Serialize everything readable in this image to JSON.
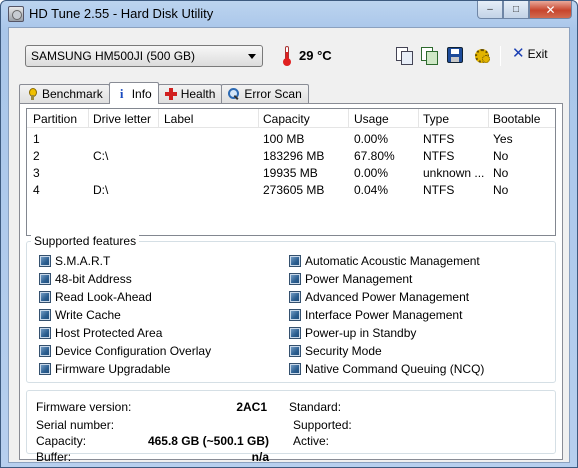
{
  "window": {
    "title": "HD Tune 2.55 - Hard Disk Utility",
    "minimize": "–",
    "maximize": "□",
    "close": "✕"
  },
  "toolbar": {
    "drive": "SAMSUNG HM500JI (500 GB)",
    "temperature": "29 °C",
    "exit_label": "Exit",
    "icons": [
      "copy-text-icon",
      "copy-screenshot-icon",
      "save-icon",
      "options-icon",
      "exit-icon"
    ]
  },
  "tabs": [
    {
      "label": "Benchmark",
      "icon": "benchmark-icon",
      "active": false
    },
    {
      "label": "Info",
      "icon": "info-icon",
      "active": true
    },
    {
      "label": "Health",
      "icon": "health-icon",
      "active": false
    },
    {
      "label": "Error Scan",
      "icon": "error-scan-icon",
      "active": false
    }
  ],
  "partitions": {
    "columns": [
      "Partition",
      "Drive letter",
      "Label",
      "Capacity",
      "Usage",
      "Type",
      "Bootable"
    ],
    "rows": [
      [
        "1",
        "",
        "",
        "100 MB",
        "0.00%",
        "NTFS",
        "Yes"
      ],
      [
        "2",
        "C:\\",
        "",
        "183296 MB",
        "67.80%",
        "NTFS",
        "No"
      ],
      [
        "3",
        "",
        "",
        "19935 MB",
        "0.00%",
        "unknown ...",
        "No"
      ],
      [
        "4",
        "D:\\",
        "",
        "273605 MB",
        "0.04%",
        "NTFS",
        "No"
      ]
    ]
  },
  "features": {
    "title": "Supported features",
    "left": [
      "S.M.A.R.T",
      "48-bit Address",
      "Read Look-Ahead",
      "Write Cache",
      "Host Protected Area",
      "Device Configuration Overlay",
      "Firmware Upgradable"
    ],
    "right": [
      "Automatic Acoustic Management",
      "Power Management",
      "Advanced Power Management",
      "Interface Power Management",
      "Power-up in Standby",
      "Security Mode",
      "Native Command Queuing (NCQ)"
    ]
  },
  "details": {
    "firmware_label": "Firmware version:",
    "firmware_value": "2AC1",
    "serial_label": "Serial number:",
    "serial_value": "",
    "capacity_label": "Capacity:",
    "capacity_value": "465.8 GB (~500.1 GB)",
    "buffer_label": "Buffer:",
    "buffer_value": "n/a",
    "standard_label": "Standard:",
    "standard_value": "",
    "supported_label": "Supported:",
    "supported_value": "",
    "active_label": "Active:",
    "active_value": ""
  }
}
